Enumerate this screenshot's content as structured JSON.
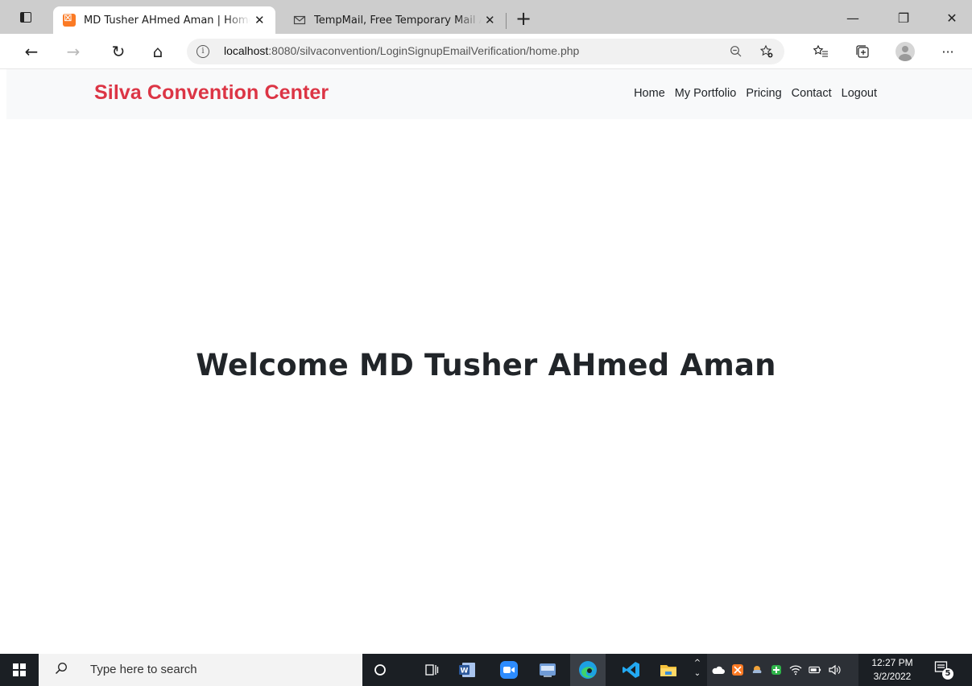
{
  "browser": {
    "tabs": [
      {
        "title": "MD Tusher AHmed Aman | Home",
        "close": "✕",
        "active": true
      },
      {
        "title": "TempMail, Free Temporary Mail Address",
        "close": "✕",
        "active": false
      }
    ],
    "new_tab": "+",
    "window_controls": {
      "minimize": "—",
      "restore": "❐",
      "close": "✕"
    },
    "nav": {
      "back": "←",
      "forward": "→",
      "refresh": "↻",
      "home": "⌂"
    },
    "url_host": "localhost",
    "url_path": ":8080/silvaconvention/LoginSignupEmailVerification/home.php",
    "menu_more": "···"
  },
  "site": {
    "brand": "Silva Convention Center",
    "brand_color": "#dc3545",
    "nav_items": [
      "Home",
      "My Portfolio",
      "Pricing",
      "Contact",
      "Logout"
    ],
    "welcome": "Welcome MD Tusher AHmed Aman"
  },
  "taskbar": {
    "search_placeholder": "Type here to search",
    "time": "12:27 PM",
    "date": "3/2/2022",
    "notification_count": "5",
    "pinned_apps": [
      "cortana-icon",
      "task-view-icon",
      "word-icon",
      "zoom-icon",
      "app-icon",
      "edge-icon",
      "vscode-icon",
      "file-explorer-icon"
    ]
  }
}
